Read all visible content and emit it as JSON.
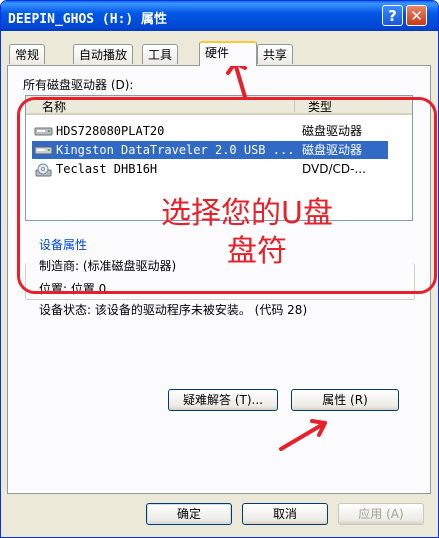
{
  "window": {
    "title": "DEEPIN_GHOS (H:) 属性"
  },
  "titlebar_buttons": {
    "help": "?",
    "close": "✕"
  },
  "tabs": [
    {
      "label": "常规"
    },
    {
      "label": "自动播放"
    },
    {
      "label": "工具"
    },
    {
      "label": "硬件"
    },
    {
      "label": "共享"
    }
  ],
  "list": {
    "caption": "所有磁盘驱动器 (D):",
    "columns": [
      "名称",
      "类型"
    ],
    "rows": [
      {
        "name": "HDS728080PLAT20",
        "type": "磁盘驱动器",
        "icon": "disk-drive-icon"
      },
      {
        "name": "Kingston DataTraveler 2.0 USB ...",
        "type": "磁盘驱动器",
        "icon": "usb-drive-icon"
      },
      {
        "name": "Teclast DHB16H",
        "type": "DVD/CD-...",
        "icon": "cd-drive-icon"
      }
    ]
  },
  "device": {
    "group_title": "设备属性",
    "manufacturer": "制造商: (标准磁盘驱动器)",
    "location": "位置: 位置 0",
    "status": "设备状态: 该设备的驱动程序未被安装。 (代码 28)"
  },
  "buttons": {
    "troubleshoot": "疑难解答 (T)...",
    "properties": "属性 (R)",
    "ok": "确定",
    "cancel": "取消",
    "apply": "应用 (A)"
  },
  "annotation": {
    "line1": "选择您的U盘",
    "line2": "盘符"
  },
  "colors": {
    "annotation": "#e8202a",
    "selection": "#316ac5",
    "title_bar": "#0058e6"
  }
}
